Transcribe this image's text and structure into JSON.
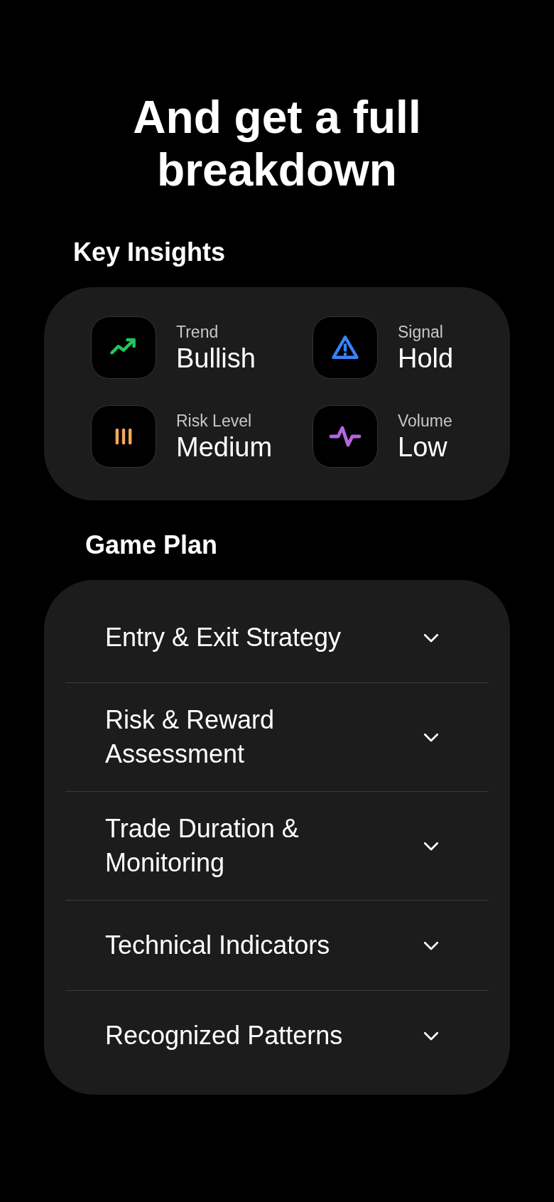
{
  "title": "And get a full breakdown",
  "insights": {
    "heading": "Key Insights",
    "items": [
      {
        "kind": "trend",
        "label": "Trend",
        "value": "Bullish",
        "color": "#22c55e"
      },
      {
        "kind": "alert",
        "label": "Signal",
        "value": "Hold",
        "color": "#3b82f6"
      },
      {
        "kind": "bars",
        "label": "Risk Level",
        "value": "Medium",
        "color": "#f5a855"
      },
      {
        "kind": "pulse",
        "label": "Volume",
        "value": "Low",
        "color": "#b565e0"
      }
    ]
  },
  "game_plan": {
    "heading": "Game Plan",
    "items": [
      {
        "label": "Entry & Exit Strategy",
        "expanded": false
      },
      {
        "label": "Risk & Reward Assessment",
        "expanded": false
      },
      {
        "label": "Trade Duration & Monitoring",
        "expanded": false
      },
      {
        "label": "Technical Indicators",
        "expanded": false
      },
      {
        "label": "Recognized Patterns",
        "expanded": false
      }
    ]
  }
}
